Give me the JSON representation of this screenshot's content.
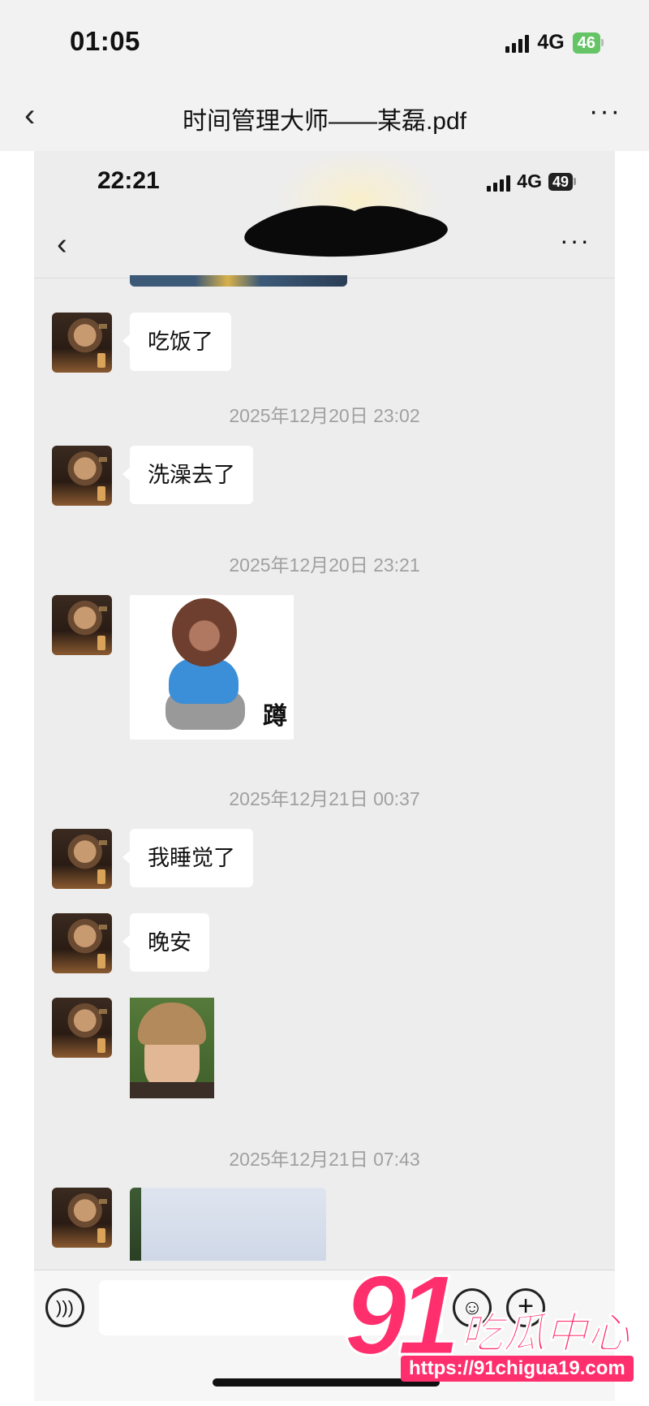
{
  "outer": {
    "status": {
      "time": "01:05",
      "network": "4G",
      "battery": "46"
    },
    "title": "时间管理大师——某磊.pdf",
    "back_icon": "‹",
    "more_icon": "···"
  },
  "inner": {
    "status": {
      "time": "22:21",
      "network": "4G",
      "battery": "49"
    },
    "back_icon": "‹",
    "more_icon": "···"
  },
  "chat": {
    "messages": [
      {
        "type": "text",
        "text": "吃饭了"
      },
      {
        "type": "timestamp",
        "text": "2025年12月20日 23:02"
      },
      {
        "type": "text",
        "text": "洗澡去了"
      },
      {
        "type": "timestamp",
        "text": "2025年12月20日 23:21"
      },
      {
        "type": "sticker",
        "label": "蹲"
      },
      {
        "type": "timestamp",
        "text": "2025年12月21日 00:37"
      },
      {
        "type": "text",
        "text": "我睡觉了"
      },
      {
        "type": "text",
        "text": "晚安"
      },
      {
        "type": "image"
      },
      {
        "type": "timestamp",
        "text": "2025年12月21日 07:43"
      },
      {
        "type": "image"
      }
    ]
  },
  "watermark": {
    "number": "91",
    "name": "吃瓜中心",
    "url": "https://91chigua19.com"
  },
  "colors": {
    "chat_bg": "#ededed",
    "bubble": "#ffffff",
    "timestamp": "#a0a0a0",
    "watermark": "#ff2f6d",
    "battery_green": "#65c466"
  }
}
